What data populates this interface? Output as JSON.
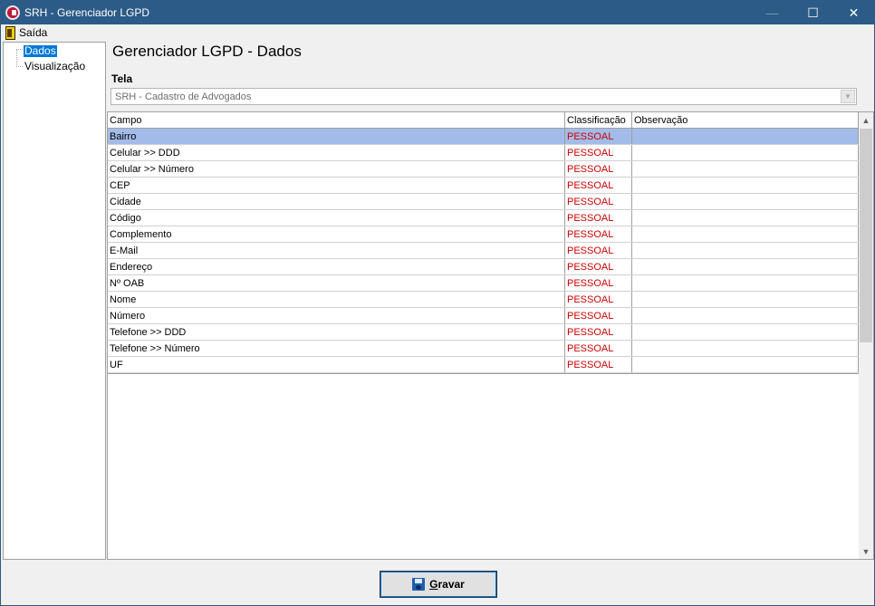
{
  "window": {
    "title": "SRH - Gerenciador LGPD",
    "minimize_glyph": "—",
    "maximize_glyph": "☐",
    "close_glyph": "✕"
  },
  "menu": {
    "exit_label": "Saída",
    "exit_icon": "exit-door-icon"
  },
  "tree": {
    "items": [
      {
        "label": "Dados",
        "selected": true
      },
      {
        "label": "Visualização",
        "selected": false
      }
    ]
  },
  "page": {
    "title": "Gerenciador LGPD - Dados"
  },
  "form": {
    "tela_label": "Tela",
    "tela_value": "SRH - Cadastro de Advogados",
    "dropdown_glyph": "▼"
  },
  "grid": {
    "headers": {
      "campo": "Campo",
      "classificacao": "Classificação",
      "observacao": "Observação"
    },
    "rows": [
      {
        "campo": "Bairro",
        "classificacao": "PESSOAL",
        "observacao": ""
      },
      {
        "campo": "Celular >> DDD",
        "classificacao": "PESSOAL",
        "observacao": ""
      },
      {
        "campo": "Celular >> Número",
        "classificacao": "PESSOAL",
        "observacao": ""
      },
      {
        "campo": "CEP",
        "classificacao": "PESSOAL",
        "observacao": ""
      },
      {
        "campo": "Cidade",
        "classificacao": "PESSOAL",
        "observacao": ""
      },
      {
        "campo": "Código",
        "classificacao": "PESSOAL",
        "observacao": ""
      },
      {
        "campo": "Complemento",
        "classificacao": "PESSOAL",
        "observacao": ""
      },
      {
        "campo": "E-Mail",
        "classificacao": "PESSOAL",
        "observacao": ""
      },
      {
        "campo": "Endereço",
        "classificacao": "PESSOAL",
        "observacao": ""
      },
      {
        "campo": "Nº OAB",
        "classificacao": "PESSOAL",
        "observacao": ""
      },
      {
        "campo": "Nome",
        "classificacao": "PESSOAL",
        "observacao": ""
      },
      {
        "campo": "Número",
        "classificacao": "PESSOAL",
        "observacao": ""
      },
      {
        "campo": "Telefone >> DDD",
        "classificacao": "PESSOAL",
        "observacao": ""
      },
      {
        "campo": "Telefone >> Número",
        "classificacao": "PESSOAL",
        "observacao": ""
      },
      {
        "campo": "UF",
        "classificacao": "PESSOAL",
        "observacao": ""
      }
    ],
    "selected_row": 0,
    "scroll_up_glyph": "▲",
    "scroll_down_glyph": "▼"
  },
  "footer": {
    "save_label_first": "G",
    "save_label_rest": "ravar"
  },
  "colors": {
    "titlebar": "#2b5b86",
    "selection": "#0078d7",
    "row_selected": "#a3bbe8",
    "classification_text": "#cc0000"
  }
}
